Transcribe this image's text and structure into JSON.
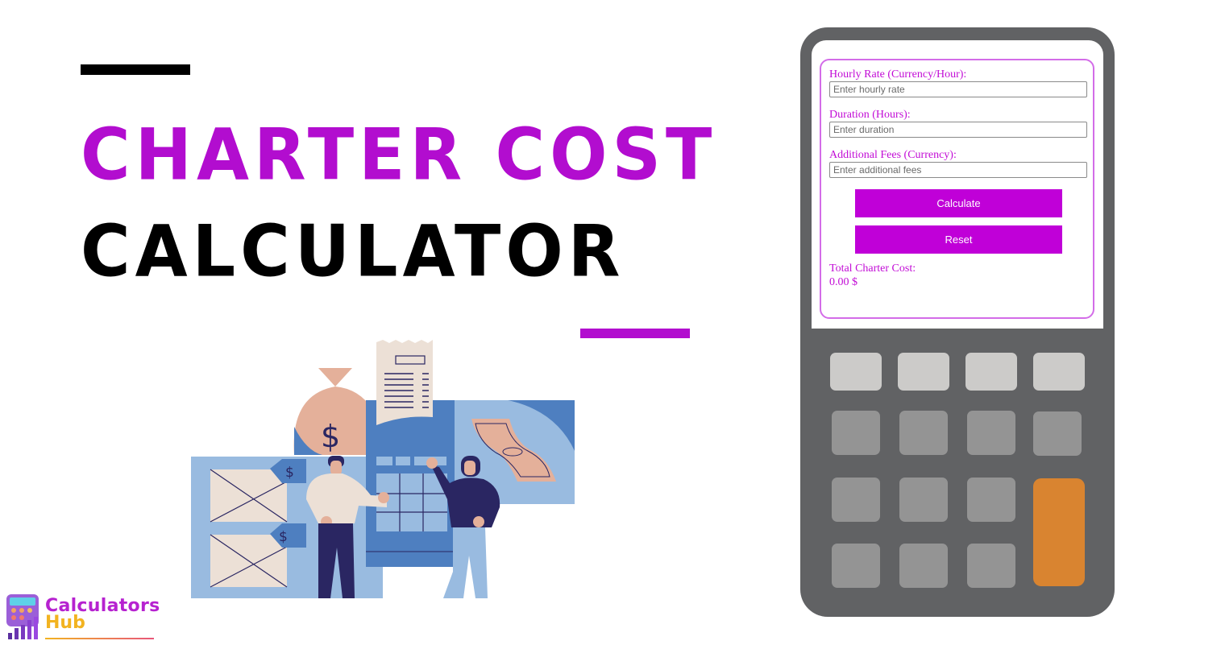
{
  "title": {
    "line1": "CHARTER COST",
    "line2": "CALCULATOR"
  },
  "brand": {
    "name_line1": "Calculators",
    "name_line2": "Hub",
    "accent": "#b20dcf"
  },
  "form": {
    "fields": [
      {
        "label": "Hourly Rate (Currency/Hour):",
        "placeholder": "Enter hourly rate",
        "value": ""
      },
      {
        "label": "Duration (Hours):",
        "placeholder": "Enter duration",
        "value": ""
      },
      {
        "label": "Additional Fees (Currency):",
        "placeholder": "Enter additional fees",
        "value": ""
      }
    ],
    "buttons": {
      "calculate": "Calculate",
      "reset": "Reset"
    },
    "result": {
      "label": "Total Charter Cost:",
      "value": "0.00 $"
    }
  },
  "colors": {
    "primary": "#c000d8",
    "calculator_body": "#616264",
    "key_light": "#cccbc9",
    "key_gray": "#949494",
    "key_orange": "#d98430"
  },
  "illustration": {
    "icons": [
      "money-bag-icon",
      "receipt-icon",
      "calculator-icon",
      "banknote-icon",
      "price-tag-icon",
      "person-icon"
    ],
    "currency_symbol": "$"
  }
}
